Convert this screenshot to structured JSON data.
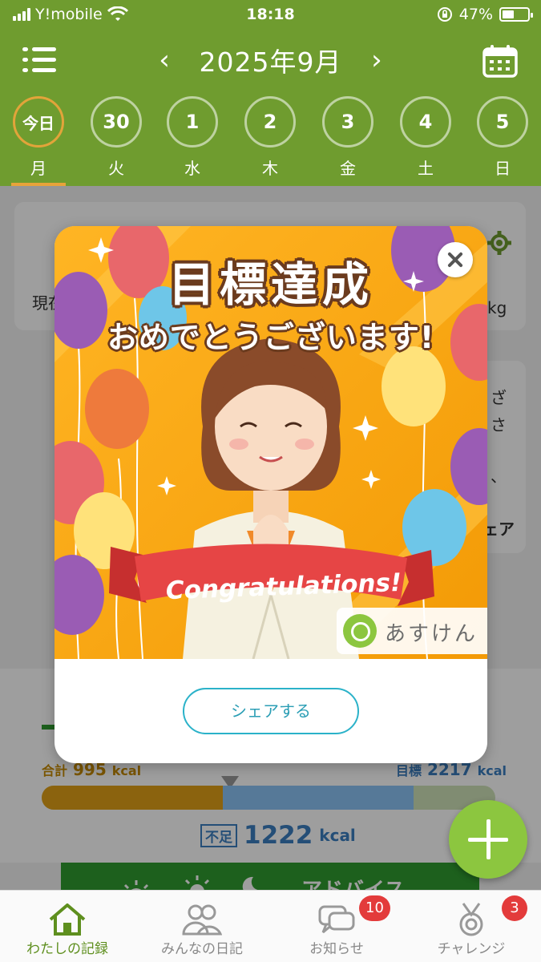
{
  "status_bar": {
    "carrier": "Y!mobile",
    "time": "18:18",
    "battery": "47%",
    "battery_level": 0.47
  },
  "header": {
    "month_title": "2025年9月",
    "prev_arrow": "‹",
    "next_arrow": "›"
  },
  "days": [
    {
      "num": "今日",
      "dow": "月",
      "today": true
    },
    {
      "num": "30",
      "dow": "火"
    },
    {
      "num": "1",
      "dow": "水"
    },
    {
      "num": "2",
      "dow": "木"
    },
    {
      "num": "3",
      "dow": "金"
    },
    {
      "num": "4",
      "dow": "土"
    },
    {
      "num": "5",
      "dow": "日"
    }
  ],
  "background": {
    "weight_label_partial": "現在",
    "weight_unit": "kg",
    "side_text_1": "ざ",
    "side_text_2": "さ",
    "side_text_3": "、",
    "side_text_4": "ェア",
    "calorie": {
      "total_label": "合計",
      "total_value": "995",
      "total_unit": "kcal",
      "goal_label": "目標",
      "goal_value": "2217",
      "goal_unit": "kcal",
      "intake_fraction": 0.4,
      "burn_fraction": 0.42,
      "deficit_label": "不足",
      "deficit_value": "1222",
      "deficit_unit": "kcal"
    },
    "advice_label": "アドバイス"
  },
  "modal": {
    "title": "目標達成",
    "subtitle": "おめでとうございます!",
    "ribbon_text": "Congratulations!",
    "brand_name": "あすけん",
    "share_button": "シェアする"
  },
  "tabbar": [
    {
      "label": "わたしの記録",
      "icon": "home-icon",
      "active": true
    },
    {
      "label": "みんなの日記",
      "icon": "people-icon"
    },
    {
      "label": "お知らせ",
      "icon": "chat-icon",
      "badge": "10"
    },
    {
      "label": "チャレンジ",
      "icon": "medal-icon",
      "badge": "3"
    }
  ],
  "colors": {
    "header_green": "#6f9c2f",
    "accent_orange": "#e8a33a",
    "fab_green": "#8cc63f",
    "share_teal": "#2bb2c9",
    "badge_red": "#e33b3b"
  }
}
